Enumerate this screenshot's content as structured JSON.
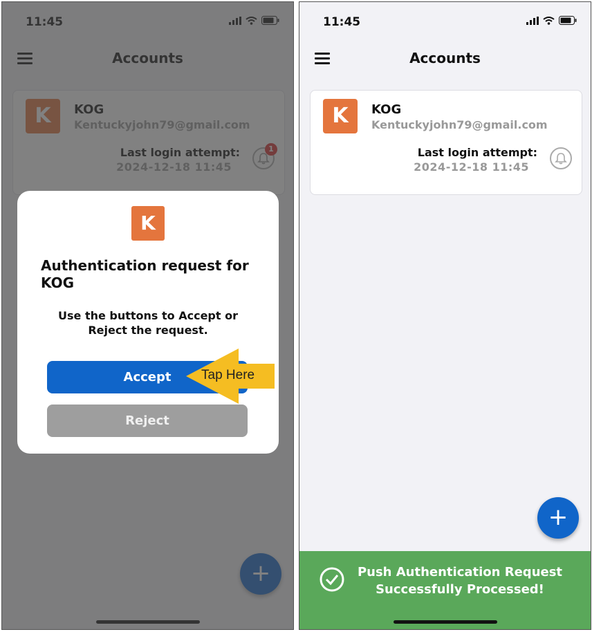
{
  "status_bar": {
    "time": "11:45"
  },
  "header": {
    "title": "Accounts"
  },
  "account": {
    "avatar_letter": "K",
    "name": "KOG",
    "email": "Kentuckyjohn79@gmail.com",
    "last_login_label": "Last login attempt:",
    "last_login_value": "2024-12-18 11:45",
    "notification_count": "1"
  },
  "modal": {
    "logo_letter": "K",
    "title": "Authentication request for KOG",
    "message": "Use the buttons to Accept or Reject the request.",
    "accept_label": "Accept",
    "reject_label": "Reject"
  },
  "callout": {
    "text": "Tap Here"
  },
  "fab": {
    "label": "+"
  },
  "toast": {
    "message": "Push Authentication Request Successfully Processed!"
  },
  "colors": {
    "accent": "#1065c9",
    "avatar": "#e4753d",
    "success": "#5aa85a",
    "badge": "#d62b2b",
    "callout": "#f5bd22"
  },
  "icons": [
    "menu-icon",
    "signal-icon",
    "wifi-icon",
    "battery-icon",
    "bell-icon",
    "plus-icon",
    "check-circle-icon",
    "arrow-callout"
  ]
}
